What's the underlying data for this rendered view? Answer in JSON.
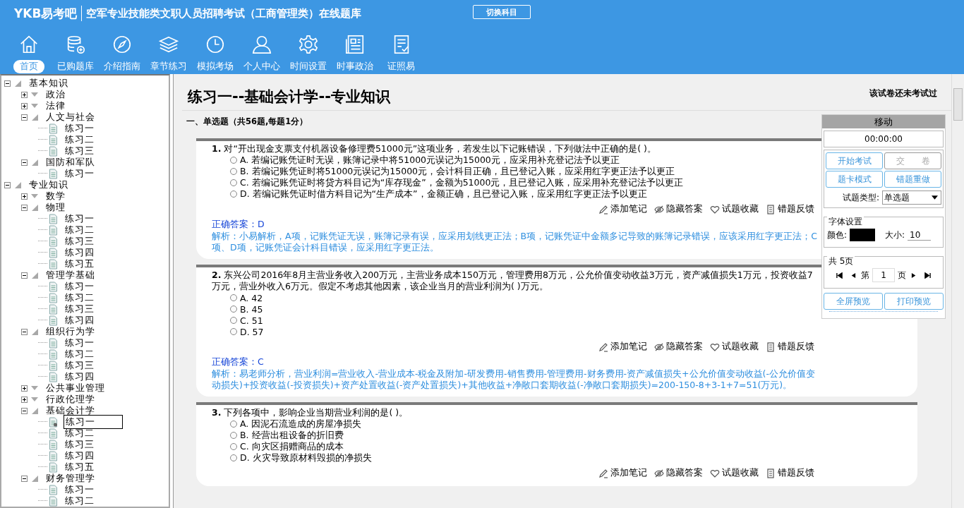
{
  "header": {
    "logo": "YKB易考吧",
    "title": "空军专业技能类文职人员招聘考试（工商管理类）在线题库",
    "switch_button": "切换科目"
  },
  "nav": [
    {
      "label": "首页",
      "selected": true
    },
    {
      "label": "已购题库",
      "selected": false
    },
    {
      "label": "介绍指南",
      "selected": false
    },
    {
      "label": "章节练习",
      "selected": false
    },
    {
      "label": "模拟考场",
      "selected": false
    },
    {
      "label": "个人中心",
      "selected": false
    },
    {
      "label": "时间设置",
      "selected": false
    },
    {
      "label": "时事政治",
      "selected": false
    },
    {
      "label": "证照易",
      "selected": false
    }
  ],
  "tree": [
    {
      "label": "基本知识",
      "expanded": true,
      "children": [
        {
          "label": "政治",
          "expanded": false
        },
        {
          "label": "法律",
          "expanded": false
        },
        {
          "label": "人文与社会",
          "expanded": true,
          "children": [
            {
              "label": "练习一",
              "selected": false
            },
            {
              "label": "练习二",
              "selected": false
            },
            {
              "label": "练习三",
              "selected": false
            }
          ]
        },
        {
          "label": "国防和军队",
          "expanded": true,
          "children": [
            {
              "label": "练习一",
              "selected": false
            }
          ]
        }
      ]
    },
    {
      "label": "专业知识",
      "expanded": true,
      "children": [
        {
          "label": "数学",
          "expanded": false
        },
        {
          "label": "物理",
          "expanded": true,
          "children": [
            {
              "label": "练习一",
              "selected": false
            },
            {
              "label": "练习二",
              "selected": false
            },
            {
              "label": "练习三",
              "selected": false
            },
            {
              "label": "练习四",
              "selected": false
            },
            {
              "label": "练习五",
              "selected": false
            }
          ]
        },
        {
          "label": "管理学基础",
          "expanded": true,
          "children": [
            {
              "label": "练习一",
              "selected": false
            },
            {
              "label": "练习二",
              "selected": false
            },
            {
              "label": "练习三",
              "selected": false
            },
            {
              "label": "练习四",
              "selected": false
            }
          ]
        },
        {
          "label": "组织行为学",
          "expanded": true,
          "children": [
            {
              "label": "练习一",
              "selected": false
            },
            {
              "label": "练习二",
              "selected": false
            },
            {
              "label": "练习三",
              "selected": false
            },
            {
              "label": "练习四",
              "selected": false
            }
          ]
        },
        {
          "label": "公共事业管理",
          "expanded": false
        },
        {
          "label": "行政伦理学",
          "expanded": false
        },
        {
          "label": "基础会计学",
          "expanded": true,
          "children": [
            {
              "label": "练习一",
              "selected": true
            },
            {
              "label": "练习二",
              "selected": false
            },
            {
              "label": "练习三",
              "selected": false
            },
            {
              "label": "练习四",
              "selected": false
            },
            {
              "label": "练习五",
              "selected": false
            }
          ]
        },
        {
          "label": "财务管理学",
          "expanded": true,
          "children": [
            {
              "label": "练习一",
              "selected": false
            },
            {
              "label": "练习二",
              "selected": false
            }
          ]
        }
      ]
    }
  ],
  "paper": {
    "title": "练习一--基础会计学--专业知识",
    "status": "该试卷还未考试过",
    "section": "一、单选题（共56题,每题1分）"
  },
  "questions": [
    {
      "number": "1.",
      "text": "对“开出现金支票支付机器设备修理费51000元”这项业务，若发生以下记账错误，下列做法中正确的是( )。",
      "options": [
        {
          "label": "A. 若编记账凭证时无误，账簿记录中将51000元误记为15000元，应采用补充登记法予以更正",
          "selected": false
        },
        {
          "label": "B. 若编记账凭证时将51000元误记为15000元，会计科目正确，且已登记入账，应采用红字更正法予以更正",
          "selected": false
        },
        {
          "label": "C. 若编记账凭证时将贷方科目记为“库存现金”，金额为51000元，且已登记入账，应采用补充登记法予以更正",
          "selected": false
        },
        {
          "label": "D. 若编记账凭证时借方科目记为“生产成本”，金额正确，且已登记入账，应采用红字更正法予以更正",
          "selected": false
        }
      ],
      "actions": [
        "添加笔记",
        "隐藏答案",
        "试题收藏",
        "错题反馈"
      ],
      "answer": "正确答案：D",
      "analysis": "解析：小易解析，A项，记账凭证无误，账簿记录有误，应采用划线更正法；B项，记账凭证中金额多记导致的账簿记录错误，应该采用红字更正法；C项、D项，记账凭证会计科目错误，应采用红字更正法。"
    },
    {
      "number": "2.",
      "text": "东兴公司2016年8月主营业务收入200万元，主营业务成本150万元，管理费用8万元，公允价值变动收益3万元，资产减值损失1万元，投资收益7万元，营业外收入6万元。假定不考虑其他因素，该企业当月的营业利润为( )万元。",
      "options": [
        {
          "label": "A. 42",
          "selected": false
        },
        {
          "label": "B. 45",
          "selected": false
        },
        {
          "label": "C. 51",
          "selected": false
        },
        {
          "label": "D. 57",
          "selected": false
        }
      ],
      "actions": [
        "添加笔记",
        "隐藏答案",
        "试题收藏",
        "错题反馈"
      ],
      "answer": "正确答案：C",
      "analysis": "解析：易老师分析，营业利润=营业收入-营业成本-税金及附加-研发费用-销售费用-管理费用-财务费用-资产减值损失+公允价值变动收益(-公允价值变动损失)+投资收益(-投资损失)+资产处置收益(-资产处置损失)+其他收益+净敞口套期收益(-净敞口套期损失)=200-150-8+3-1+7=51(万元)。"
    },
    {
      "number": "3.",
      "text": "下列各项中，影响企业当期营业利润的是( )。",
      "options": [
        {
          "label": "A. 因泥石流造成的房屋净损失",
          "selected": false
        },
        {
          "label": "B. 经营出租设备的折旧费",
          "selected": false
        },
        {
          "label": "C. 向灾区捐赠商品的成本",
          "selected": false
        },
        {
          "label": "D. 火灾导致原材料毁损的净损失",
          "selected": false
        }
      ],
      "actions": [
        "添加笔记",
        "隐藏答案",
        "试题收藏",
        "错题反馈"
      ]
    }
  ],
  "panel": {
    "title": "移动",
    "timer": "00:00:00",
    "buttons": [
      {
        "label": "开始考试",
        "disabled": false
      },
      {
        "label": "交　　卷",
        "disabled": true
      },
      {
        "label": "题卡模式",
        "disabled": false
      },
      {
        "label": "错题重做",
        "disabled": false
      }
    ],
    "type_label": "试题类型:",
    "type_value": "单选题",
    "font_legend": "字体设置",
    "color_label": "颜色:",
    "color": "#000000",
    "size_label": "大小:",
    "size_value": "10",
    "pages_legend": "共 5页",
    "page_prefix": "第",
    "page_value": "1",
    "page_suffix": "页",
    "bottom_buttons": [
      "全屏预览",
      "打印预览"
    ]
  }
}
